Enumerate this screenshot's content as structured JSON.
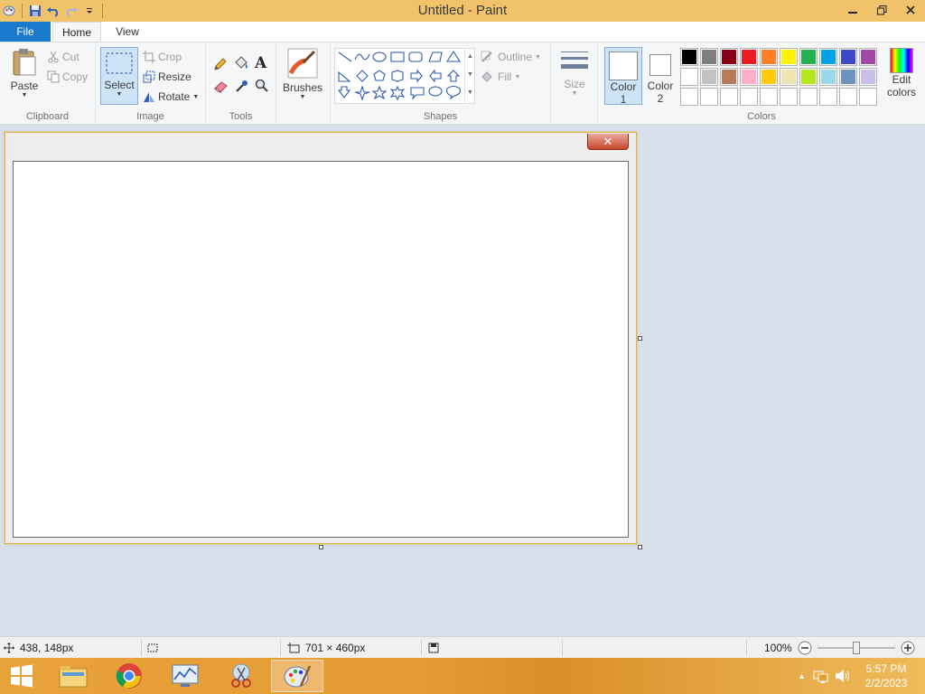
{
  "window": {
    "title": "Untitled - Paint"
  },
  "tabs": {
    "file": "File",
    "home": "Home",
    "view": "View"
  },
  "clipboard": {
    "paste": "Paste",
    "cut": "Cut",
    "copy": "Copy",
    "label": "Clipboard"
  },
  "image": {
    "select": "Select",
    "crop": "Crop",
    "resize": "Resize",
    "rotate": "Rotate",
    "label": "Image"
  },
  "tools": {
    "label": "Tools"
  },
  "brushes": {
    "label": "Brushes"
  },
  "shapes": {
    "outline": "Outline",
    "fill": "Fill",
    "label": "Shapes"
  },
  "size": {
    "label": "Size"
  },
  "color1": {
    "line1": "Color",
    "line2": "1"
  },
  "color2": {
    "line1": "Color",
    "line2": "2"
  },
  "colors": {
    "label": "Colors",
    "edit_line1": "Edit",
    "edit_line2": "colors",
    "row1": [
      "#000000",
      "#7f7f7f",
      "#880015",
      "#ed1c24",
      "#ff7f27",
      "#fff200",
      "#22b14c",
      "#00a2e8",
      "#3f48cc",
      "#a349a4"
    ],
    "row2": [
      "#ffffff",
      "#c3c3c3",
      "#b97a57",
      "#ffaec9",
      "#ffc90e",
      "#efe4b0",
      "#b5e61d",
      "#99d9ea",
      "#7092be",
      "#c8bfe7"
    ],
    "row3": [
      "#ffffff",
      "#ffffff",
      "#ffffff",
      "#ffffff",
      "#ffffff",
      "#ffffff",
      "#ffffff",
      "#ffffff",
      "#ffffff",
      "#ffffff"
    ]
  },
  "status": {
    "cursor_pos": "438, 148px",
    "canvas_size": "701 × 460px",
    "zoom": "100%"
  },
  "clock": {
    "time": "5:57 PM",
    "date": "2/2/2023"
  },
  "accent": {
    "title_bar": "#f0c36a",
    "file_tab": "#1979ca",
    "taskbar": "#e59c34"
  }
}
